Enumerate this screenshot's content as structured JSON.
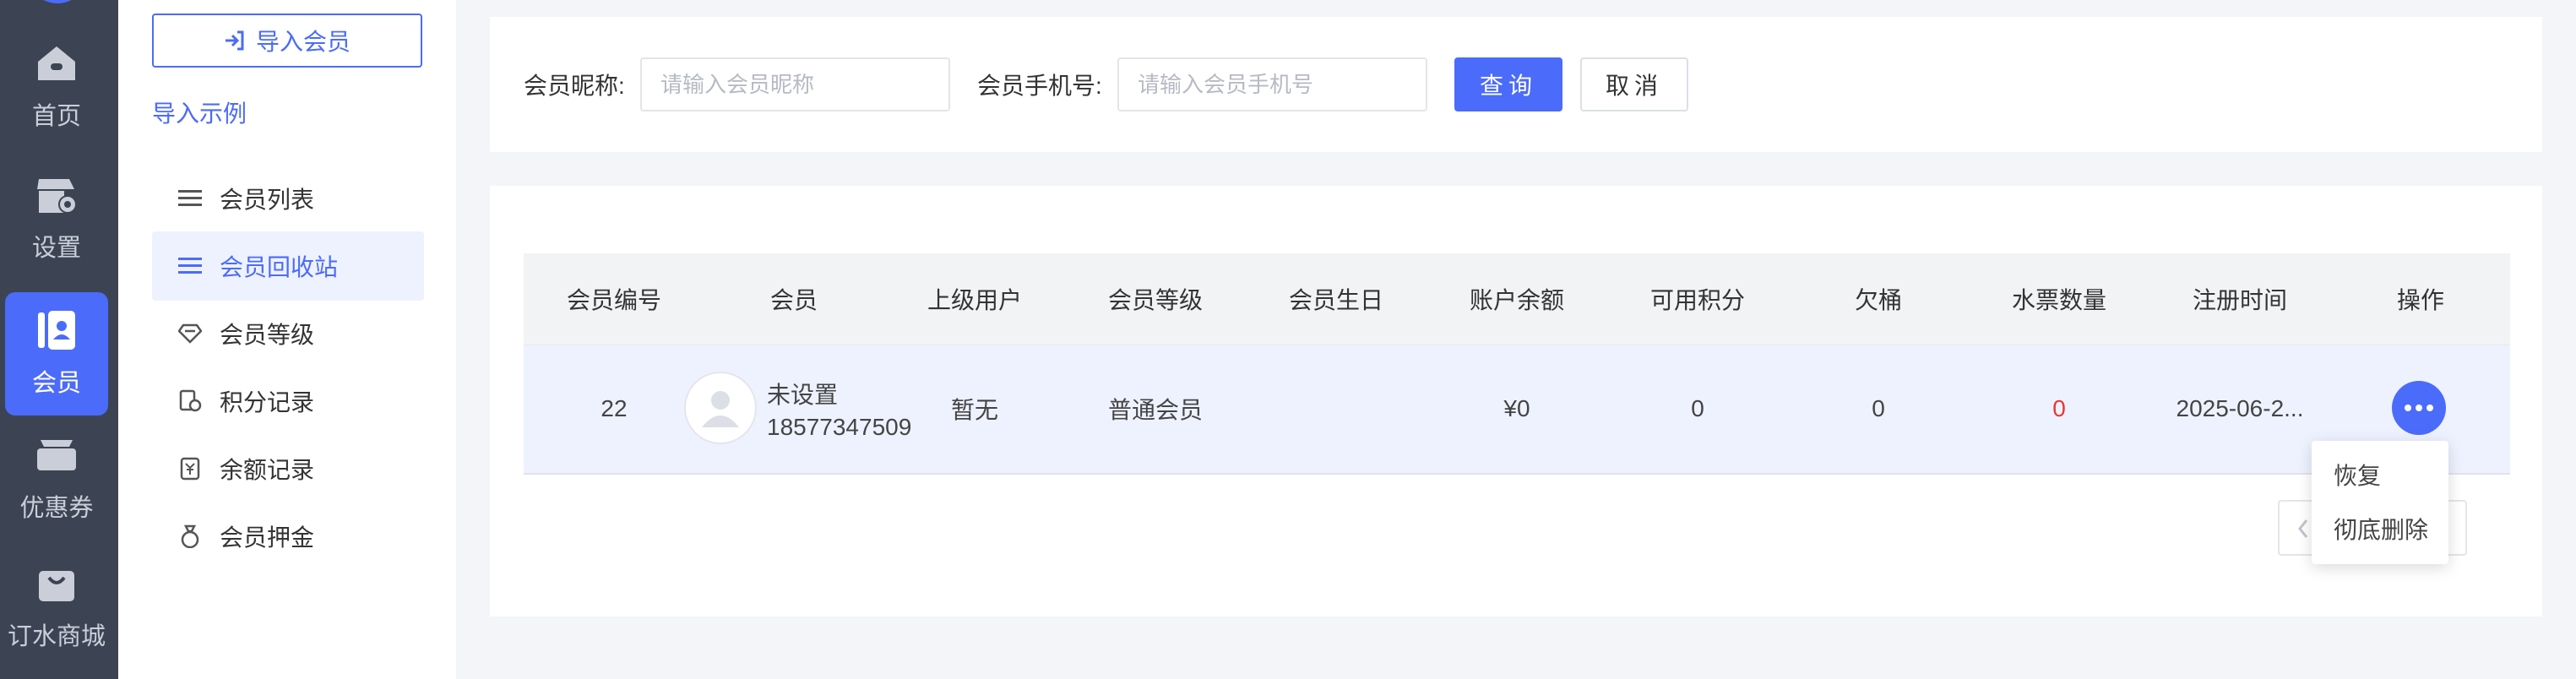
{
  "nav": {
    "items": [
      {
        "label": "首页",
        "icon": "home-icon"
      },
      {
        "label": "设置",
        "icon": "settings-icon"
      },
      {
        "label": "会员",
        "icon": "member-icon",
        "active": true
      },
      {
        "label": "优惠券",
        "icon": "coupon-icon"
      },
      {
        "label": "订水商城",
        "icon": "shop-bag-icon"
      }
    ]
  },
  "sidebar": {
    "import_button": "导入会员",
    "import_example": "导入示例",
    "items": [
      {
        "label": "会员列表",
        "icon": "list-icon"
      },
      {
        "label": "会员回收站",
        "icon": "list-icon",
        "active": true
      },
      {
        "label": "会员等级",
        "icon": "diamond-icon"
      },
      {
        "label": "积分记录",
        "icon": "points-icon"
      },
      {
        "label": "余额记录",
        "icon": "balance-icon"
      },
      {
        "label": "会员押金",
        "icon": "deposit-icon"
      }
    ]
  },
  "search": {
    "nickname_label": "会员昵称:",
    "nickname_placeholder": "请输入会员昵称",
    "phone_label": "会员手机号:",
    "phone_placeholder": "请输入会员手机号",
    "query_button": "查询",
    "cancel_button": "取消"
  },
  "table": {
    "columns": [
      "会员编号",
      "会员",
      "上级用户",
      "会员等级",
      "会员生日",
      "账户余额",
      "可用积分",
      "欠桶",
      "水票数量",
      "注册时间",
      "操作"
    ],
    "rows": [
      {
        "id": "22",
        "member_name": "未设置",
        "member_phone": "18577347509",
        "superior": "暂无",
        "level": "普通会员",
        "birthday": "",
        "balance": "¥0",
        "points": "0",
        "owed_buckets": "0",
        "water_tickets": "0",
        "register_time": "2025-06-2..."
      }
    ]
  },
  "action_menu": {
    "items": [
      "恢复",
      "彻底删除"
    ]
  },
  "colors": {
    "accent": "#4b6bfa",
    "nav_bg": "#3c4453",
    "danger": "#e53935"
  }
}
